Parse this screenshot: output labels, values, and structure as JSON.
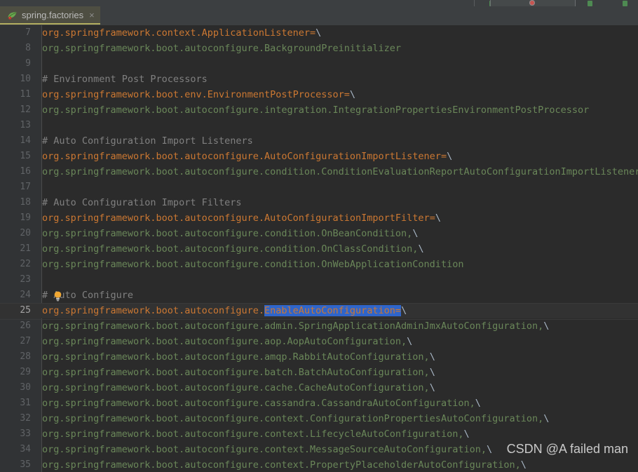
{
  "toolbar": {
    "search_placeholder": "",
    "icons": [
      "run-icon",
      "debug-icon",
      "search-icon",
      "settings-icon",
      "notification-icon"
    ]
  },
  "tab": {
    "label": "spring.factories",
    "close_label": "×",
    "icon": "spring-boot-leaf-icon"
  },
  "editor": {
    "current_line": 25,
    "selection_text": "EnableAutoConfiguration",
    "intention_icon": "lightbulb-icon",
    "colors": {
      "background": "#2b2b2b",
      "gutter": "#313335",
      "comment": "#808080",
      "key": "#cc7832",
      "value": "#6a8759",
      "separator": "#a9b7c6",
      "selection": "#2f65ca",
      "current_line": "#323232",
      "tab_active": "#4e4e42",
      "tab_underline": "#b3ae60"
    },
    "lines": [
      {
        "n": 7,
        "segs": [
          {
            "t": "org.springframework.context.ApplicationListener",
            "c": "key"
          },
          {
            "t": "=",
            "c": "key"
          },
          {
            "t": "\\",
            "c": "sep"
          }
        ]
      },
      {
        "n": 8,
        "segs": [
          {
            "t": "org.springframework.boot.autoconfigure.BackgroundPreinitializer",
            "c": "val"
          }
        ]
      },
      {
        "n": 9,
        "segs": []
      },
      {
        "n": 10,
        "segs": [
          {
            "t": "# Environment Post Processors",
            "c": "comment"
          }
        ]
      },
      {
        "n": 11,
        "segs": [
          {
            "t": "org.springframework.boot.env.EnvironmentPostProcessor",
            "c": "key"
          },
          {
            "t": "=",
            "c": "key"
          },
          {
            "t": "\\",
            "c": "sep"
          }
        ]
      },
      {
        "n": 12,
        "segs": [
          {
            "t": "org.springframework.boot.autoconfigure.integration.IntegrationPropertiesEnvironmentPostProcessor",
            "c": "val"
          }
        ]
      },
      {
        "n": 13,
        "segs": []
      },
      {
        "n": 14,
        "segs": [
          {
            "t": "# Auto Configuration Import Listeners",
            "c": "comment"
          }
        ]
      },
      {
        "n": 15,
        "segs": [
          {
            "t": "org.springframework.boot.autoconfigure.AutoConfigurationImportListener",
            "c": "key"
          },
          {
            "t": "=",
            "c": "key"
          },
          {
            "t": "\\",
            "c": "sep"
          }
        ]
      },
      {
        "n": 16,
        "segs": [
          {
            "t": "org.springframework.boot.autoconfigure.condition.ConditionEvaluationReportAutoConfigurationImportListener",
            "c": "val"
          }
        ]
      },
      {
        "n": 17,
        "segs": []
      },
      {
        "n": 18,
        "segs": [
          {
            "t": "# Auto Configuration Import Filters",
            "c": "comment"
          }
        ]
      },
      {
        "n": 19,
        "segs": [
          {
            "t": "org.springframework.boot.autoconfigure.AutoConfigurationImportFilter",
            "c": "key"
          },
          {
            "t": "=",
            "c": "key"
          },
          {
            "t": "\\",
            "c": "sep"
          }
        ]
      },
      {
        "n": 20,
        "segs": [
          {
            "t": "org.springframework.boot.autoconfigure.condition.OnBeanCondition,",
            "c": "val"
          },
          {
            "t": "\\",
            "c": "sep"
          }
        ]
      },
      {
        "n": 21,
        "segs": [
          {
            "t": "org.springframework.boot.autoconfigure.condition.OnClassCondition,",
            "c": "val"
          },
          {
            "t": "\\",
            "c": "sep"
          }
        ]
      },
      {
        "n": 22,
        "segs": [
          {
            "t": "org.springframework.boot.autoconfigure.condition.OnWebApplicationCondition",
            "c": "val"
          }
        ]
      },
      {
        "n": 23,
        "segs": []
      },
      {
        "n": 24,
        "segs": [
          {
            "t": "# Auto Configure",
            "c": "comment"
          }
        ],
        "bulb": true
      },
      {
        "n": 25,
        "current": true,
        "segs": [
          {
            "t": "org.springframework.boot.autoconfigure.",
            "c": "key"
          },
          {
            "t": "EnableAutoConfiguration=",
            "c": "sel"
          },
          {
            "t": "\\",
            "c": "sep"
          }
        ]
      },
      {
        "n": 26,
        "segs": [
          {
            "t": "org.springframework.boot.autoconfigure.admin.SpringApplicationAdminJmxAutoConfiguration,",
            "c": "val"
          },
          {
            "t": "\\",
            "c": "sep"
          }
        ]
      },
      {
        "n": 27,
        "segs": [
          {
            "t": "org.springframework.boot.autoconfigure.aop.AopAutoConfiguration,",
            "c": "val"
          },
          {
            "t": "\\",
            "c": "sep"
          }
        ]
      },
      {
        "n": 28,
        "segs": [
          {
            "t": "org.springframework.boot.autoconfigure.amqp.RabbitAutoConfiguration,",
            "c": "val"
          },
          {
            "t": "\\",
            "c": "sep"
          }
        ]
      },
      {
        "n": 29,
        "segs": [
          {
            "t": "org.springframework.boot.autoconfigure.batch.BatchAutoConfiguration,",
            "c": "val"
          },
          {
            "t": "\\",
            "c": "sep"
          }
        ]
      },
      {
        "n": 30,
        "segs": [
          {
            "t": "org.springframework.boot.autoconfigure.cache.CacheAutoConfiguration,",
            "c": "val"
          },
          {
            "t": "\\",
            "c": "sep"
          }
        ]
      },
      {
        "n": 31,
        "segs": [
          {
            "t": "org.springframework.boot.autoconfigure.cassandra.CassandraAutoConfiguration,",
            "c": "val"
          },
          {
            "t": "\\",
            "c": "sep"
          }
        ]
      },
      {
        "n": 32,
        "segs": [
          {
            "t": "org.springframework.boot.autoconfigure.context.ConfigurationPropertiesAutoConfiguration,",
            "c": "val"
          },
          {
            "t": "\\",
            "c": "sep"
          }
        ]
      },
      {
        "n": 33,
        "segs": [
          {
            "t": "org.springframework.boot.autoconfigure.context.LifecycleAutoConfiguration,",
            "c": "val"
          },
          {
            "t": "\\",
            "c": "sep"
          }
        ]
      },
      {
        "n": 34,
        "segs": [
          {
            "t": "org.springframework.boot.autoconfigure.context.MessageSourceAutoConfiguration,",
            "c": "val"
          },
          {
            "t": "\\",
            "c": "sep"
          }
        ]
      },
      {
        "n": 35,
        "segs": [
          {
            "t": "org.springframework.boot.autoconfigure.context.PropertyPlaceholderAutoConfiguration,",
            "c": "val"
          },
          {
            "t": "\\",
            "c": "sep"
          }
        ]
      }
    ]
  },
  "watermark": {
    "text": "CSDN @A failed man"
  }
}
